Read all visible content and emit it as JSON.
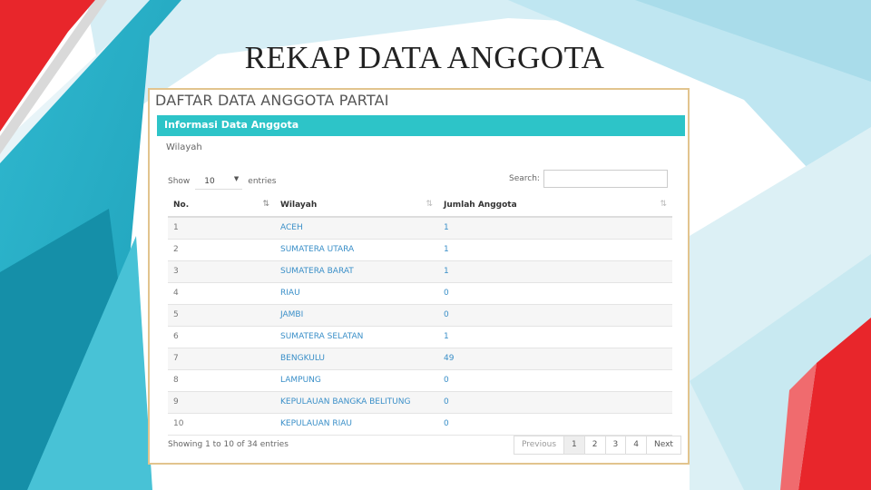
{
  "slide": {
    "title": "REKAP DATA ANGGOTA"
  },
  "page": {
    "heading": "DAFTAR DATA ANGGOTA PARTAI"
  },
  "panel": {
    "header": "Informasi Data Anggota",
    "subtitle": "Wilayah"
  },
  "controls": {
    "show_label": "Show",
    "entries_value": "10",
    "entries_label": "entries",
    "search_label": "Search:",
    "search_value": ""
  },
  "table": {
    "columns": [
      "No.",
      "Wilayah",
      "Jumlah Anggota"
    ],
    "rows": [
      [
        "1",
        "ACEH",
        "1"
      ],
      [
        "2",
        "SUMATERA UTARA",
        "1"
      ],
      [
        "3",
        "SUMATERA BARAT",
        "1"
      ],
      [
        "4",
        "RIAU",
        "0"
      ],
      [
        "5",
        "JAMBI",
        "0"
      ],
      [
        "6",
        "SUMATERA SELATAN",
        "1"
      ],
      [
        "7",
        "BENGKULU",
        "49"
      ],
      [
        "8",
        "LAMPUNG",
        "0"
      ],
      [
        "9",
        "KEPULAUAN BANGKA BELITUNG",
        "0"
      ],
      [
        "10",
        "KEPULAUAN RIAU",
        "0"
      ]
    ]
  },
  "footer": {
    "info": "Showing 1 to 10 of 34 entries",
    "pagination": [
      "Previous",
      "1",
      "2",
      "3",
      "4",
      "Next"
    ]
  },
  "colors": {
    "header_teal": "#2dc4c8",
    "link_blue": "#3a8fc8",
    "accent_red": "#e8262b",
    "frame_border": "#e2c48e"
  },
  "icons": {
    "sort_asc": "sort-asc-icon",
    "sort_both": "sort-both-icon",
    "dropdown": "chevron-down-icon"
  }
}
